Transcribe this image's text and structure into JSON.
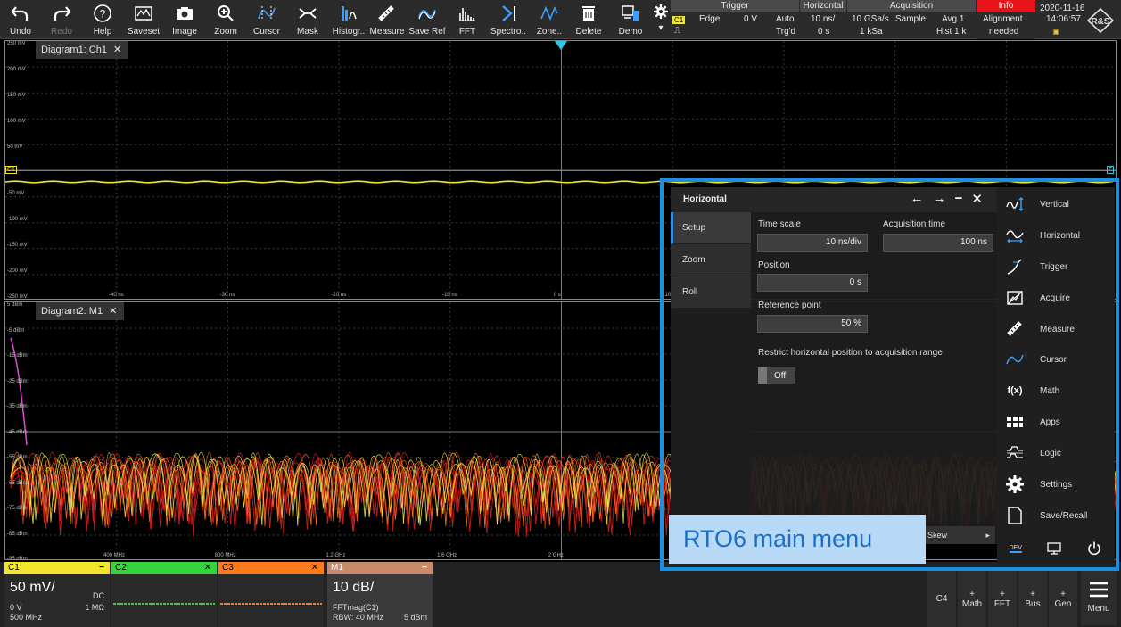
{
  "toolbar": {
    "buttons": [
      {
        "label": "Undo",
        "icon": "undo-icon"
      },
      {
        "label": "Redo",
        "icon": "redo-icon"
      },
      {
        "label": "Help",
        "icon": "help-icon"
      },
      {
        "label": "Saveset",
        "icon": "saveset-icon"
      },
      {
        "label": "Image",
        "icon": "camera-icon"
      },
      {
        "label": "Zoom",
        "icon": "zoom-icon"
      },
      {
        "label": "Cursor",
        "icon": "cursor-icon"
      },
      {
        "label": "Mask",
        "icon": "mask-icon"
      },
      {
        "label": "Histogr..",
        "icon": "histogram-icon"
      },
      {
        "label": "Measure",
        "icon": "measure-icon"
      },
      {
        "label": "Save Ref",
        "icon": "save-ref-icon"
      },
      {
        "label": "FFT",
        "icon": "fft-icon"
      },
      {
        "label": "Spectro..",
        "icon": "spectrogram-icon"
      },
      {
        "label": "Zone..",
        "icon": "zone-icon"
      },
      {
        "label": "Delete",
        "icon": "trash-icon"
      },
      {
        "label": "Demo",
        "icon": "demo-icon"
      }
    ]
  },
  "status": {
    "trigger": {
      "title": "Trigger",
      "channel": "C1",
      "type": "Edge",
      "level": "0 V",
      "mode": "Auto",
      "state": "Trg'd"
    },
    "horizontal": {
      "title": "Horizontal",
      "scale": "10 ns/",
      "position": "0 s"
    },
    "acquisition": {
      "title": "Acquisition",
      "rate": "10 GSa/s",
      "record": "1 kSa",
      "mode": "Sample",
      "avg": "Avg 1",
      "hist": "Hist 1 k"
    },
    "info": {
      "title": "Info",
      "line1": "Alignment",
      "line2": "needed"
    },
    "date": "2020-11-16",
    "time": "14:06:57"
  },
  "diagram1": {
    "tab": "Diagram1: Ch1",
    "y_labels": [
      "250 mV",
      "200 mV",
      "150 mV",
      "100 mV",
      "50 mV",
      "-50 mV",
      "-100 mV",
      "-150 mV",
      "-200 mV",
      "-250 mV"
    ],
    "x_labels": [
      "-40 ns",
      "-30 ns",
      "-20 ns",
      "-10 ns",
      "0 s",
      "10 ns"
    ]
  },
  "diagram2": {
    "tab": "Diagram2: M1",
    "y_labels": [
      "5 dBm",
      "-5 dBm",
      "-15 dBm",
      "-25 dBm",
      "-35 dBm",
      "-45 dBm",
      "-55 dBm",
      "-65 dBm",
      "-75 dBm",
      "-85 dBm",
      "-95 dBm"
    ],
    "x_labels": [
      "400 MHz",
      "800 MHz",
      "1.2 GHz",
      "1.6 GHz",
      "2 GHz"
    ]
  },
  "dialog": {
    "title": "Horizontal",
    "tabs": [
      "Setup",
      "Zoom",
      "Roll"
    ],
    "time_scale_label": "Time scale",
    "time_scale_value": "10 ns/div",
    "acq_time_label": "Acquisition time",
    "acq_time_value": "100 ns",
    "position_label": "Position",
    "position_value": "0 s",
    "ref_point_label": "Reference point",
    "ref_point_value": "50 %",
    "restrict_label": "Restrict horizontal position to acquisition range",
    "restrict_value": "Off"
  },
  "skew_label": "Skew",
  "main_menu": {
    "items": [
      {
        "label": "Vertical",
        "icon": "vertical-icon"
      },
      {
        "label": "Horizontal",
        "icon": "horizontal-icon"
      },
      {
        "label": "Trigger",
        "icon": "trigger-icon"
      },
      {
        "label": "Acquire",
        "icon": "acquire-icon"
      },
      {
        "label": "Measure",
        "icon": "measure-icon"
      },
      {
        "label": "Cursor",
        "icon": "cursor-icon"
      },
      {
        "label": "Math",
        "icon": "math-icon"
      },
      {
        "label": "Apps",
        "icon": "apps-icon"
      },
      {
        "label": "Logic",
        "icon": "logic-icon"
      },
      {
        "label": "Settings",
        "icon": "gear-icon"
      },
      {
        "label": "Save/Recall",
        "icon": "save-recall-icon"
      }
    ]
  },
  "callout": "RTO6 main menu",
  "channels": {
    "c1": {
      "name": "C1",
      "scale": "50 mV/",
      "coupling": "DC",
      "offset": "0 V",
      "impedance": "1 MΩ",
      "bandwidth": "500 MHz",
      "color": "#f2e62a"
    },
    "c2": {
      "name": "C2",
      "color": "#35d43d"
    },
    "c3": {
      "name": "C3",
      "color": "#ff7a1a"
    },
    "m1": {
      "name": "M1",
      "scale": "10 dB/",
      "source": "FFTmag(C1)",
      "rbw": "RBW: 40 MHz",
      "ref": "5 dBm",
      "color": "#c98a6c"
    }
  },
  "right_buttons": [
    {
      "plus": "",
      "label": "C4"
    },
    {
      "plus": "+",
      "label": "Math"
    },
    {
      "plus": "+",
      "label": "FFT"
    },
    {
      "plus": "+",
      "label": "Bus"
    },
    {
      "plus": "+",
      "label": "Gen"
    }
  ],
  "menu_button": "Menu"
}
